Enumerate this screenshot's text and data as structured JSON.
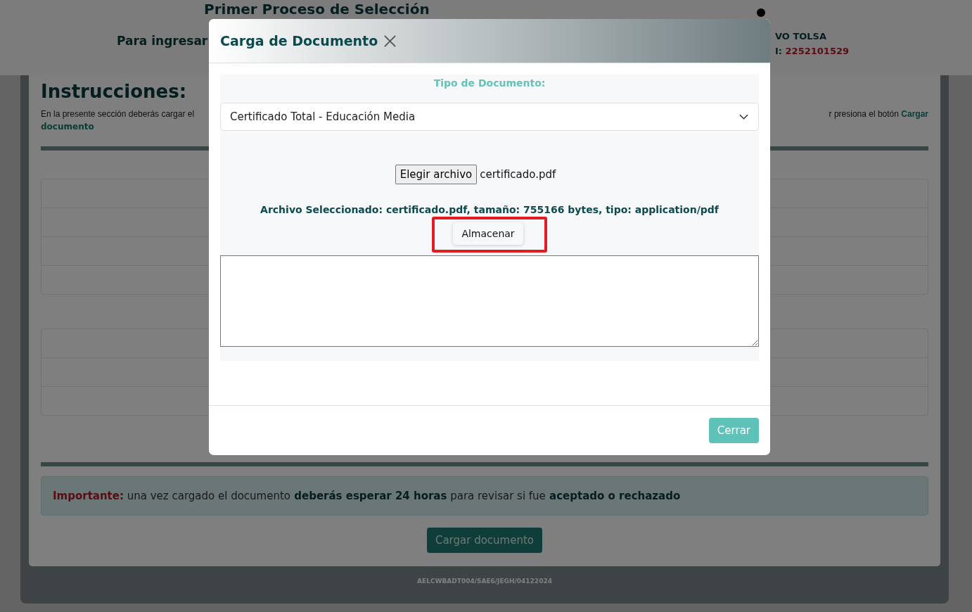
{
  "page": {
    "title": "Primer Proceso de Selección",
    "subtitle": "Para ingresar",
    "user_name": "VO TOLSA",
    "user_id_label": "I:",
    "user_id": "2252101529",
    "instructions_title": "Instrucciones:",
    "instructions_left": "En la presente sección deberás cargar el",
    "instructions_right": "r presiona el botón",
    "instructions_link": [
      "Cargar",
      "documento"
    ],
    "notice": [
      {
        "kind": "label",
        "text": "Importante:"
      },
      {
        "kind": "plain",
        "text": "una vez cargado el documento"
      },
      {
        "kind": "bold",
        "text": "deberás esperar 24 horas"
      },
      {
        "kind": "plain",
        "text": "para revisar si fue"
      },
      {
        "kind": "bold",
        "text": "aceptado o rechazado"
      }
    ],
    "upload_button": "Cargar documento",
    "footer_code": "AELCWBADT004/SAE6/JEGH/04122024"
  },
  "modal": {
    "title": "Carga de Documento",
    "document_type_label": "Tipo de Documento:",
    "document_type": "Certificado Total - Educación Media",
    "file_button": "Elegir archivo",
    "file_name": "certificado.pdf",
    "file_info": "Archivo Seleccionado: certificado.pdf, tamaño: 755166 bytes, tipo: application/pdf",
    "store_button": "Almacenar",
    "store_highlighted": true,
    "close_button": "Cerrar"
  }
}
